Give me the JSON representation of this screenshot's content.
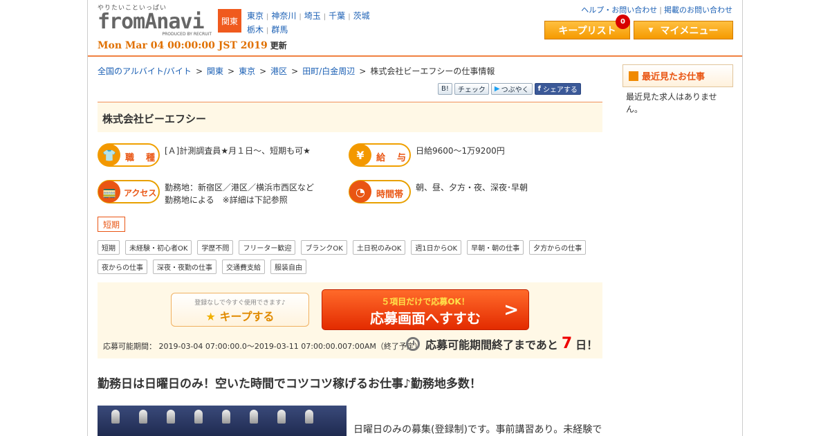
{
  "header": {
    "tagline": "やりたいこといっぱい",
    "logo_text": "fromAnavi",
    "logo_sub": "PRODUCED BY RECRUIT",
    "datestamp": "Mon Mar 04 00:00:00 JST 2019",
    "updated_label": "更新",
    "region": "関東",
    "prefectures": [
      "東京",
      "神奈川",
      "埼玉",
      "千葉",
      "茨城",
      "栃木",
      "群馬"
    ],
    "help_link": "ヘルプ・お問い合わせ",
    "listing_link": "掲載のお問い合わせ",
    "keep_list_label": "キープリスト",
    "keep_count": "0",
    "my_menu_label": "マイメニュー"
  },
  "breadcrumb": [
    "全国のアルバイト/バイト",
    "関東",
    "東京",
    "港区",
    "田町/白金周辺"
  ],
  "breadcrumb_current": "株式会社ビーエフシーの仕事情報",
  "social": {
    "hatena": "B!",
    "check": "チェック",
    "tweet": "つぶやく",
    "share": "シェアする"
  },
  "company": "株式会社ビーエフシー",
  "info": {
    "job_label": "職　種",
    "job_value": "[Ａ]計測調査員★月１日～、短期も可★",
    "pay_label": "給　与",
    "pay_value": "日給9600～1万9200円",
    "access_label": "アクセス",
    "access_line1": "勤務地：新宿区／港区／横浜市西区など",
    "access_line2": "勤務地による　※詳細は下記参照",
    "time_label": "時間帯",
    "time_value": "朝、昼、夕方・夜、深夜･早朝"
  },
  "term_tag": "短期",
  "chips": [
    "短期",
    "未経験・初心者OK",
    "学歴不問",
    "フリーター歓迎",
    "ブランクOK",
    "土日祝のみOK",
    "週1日からOK",
    "早朝・朝の仕事",
    "夕方からの仕事",
    "夜からの仕事",
    "深夜・夜勤の仕事",
    "交通費支給",
    "服装自由"
  ],
  "apply": {
    "keep_sub": "登録なしで今すぐ使用できます♪",
    "keep_label": "キープする",
    "go_sub": "５項目だけで応募OK！",
    "go_label": "応募画面へすすむ",
    "period": "応募可能期間：  2019-03-04 07:00:00.0～2019-03-11 07:00:00.007:00AM（終了予定）",
    "remain_prefix": "応募可能期間終了まであと",
    "remain_days": "7",
    "remain_suffix": "日！"
  },
  "headline": "勤務日は日曜日のみ！空いた時間でコツコツ稼げるお仕事♪勤務地多数！",
  "body_text": "日曜日のみの募集(登録制)です。事前講習あり。未経験で",
  "sidebar": {
    "title": "最近見たお仕事",
    "empty": "最近見た求人はありません。"
  },
  "colors": {
    "accent": "#e95513",
    "orange": "#f39800",
    "link": "#1a5fb4"
  }
}
